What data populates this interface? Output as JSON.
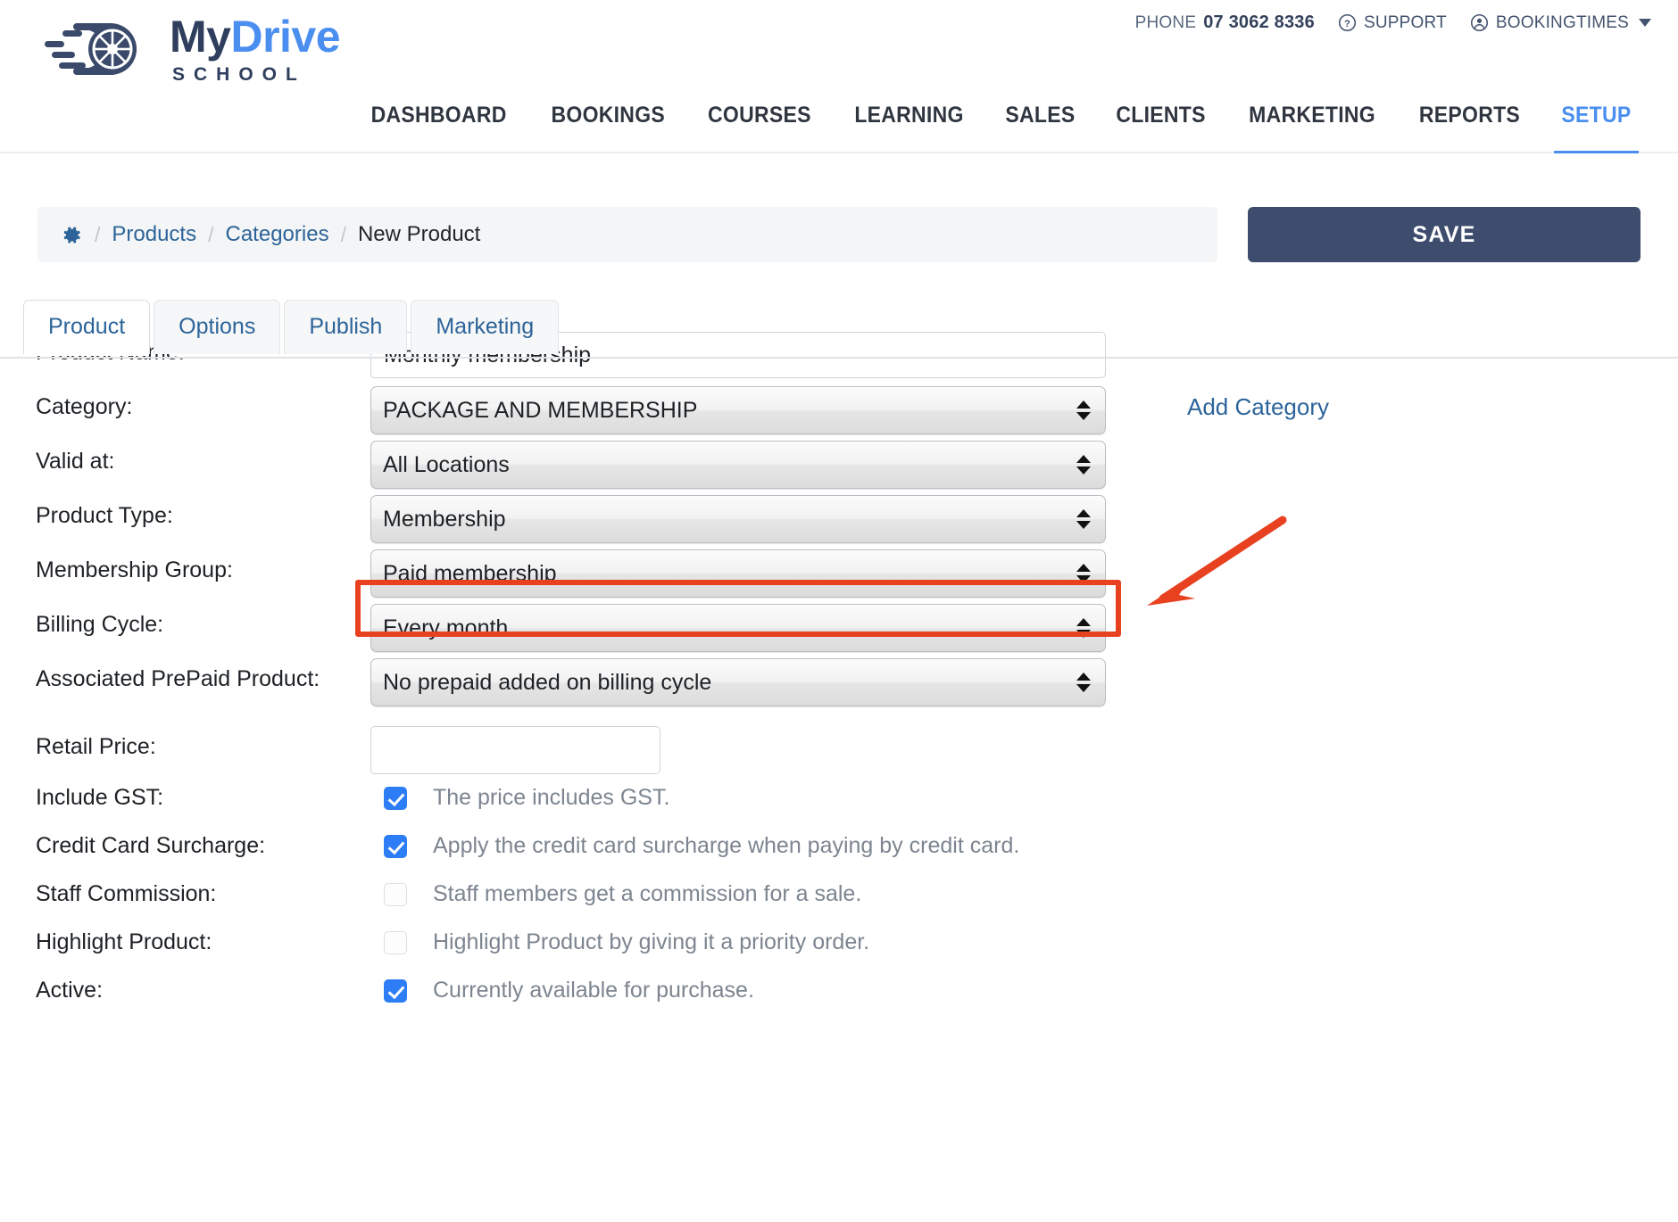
{
  "brand": {
    "logo_my": "My",
    "logo_drive": "Drive",
    "logo_sub": "SCHOOL",
    "logo_icon": "wheel-speed-icon"
  },
  "utility": {
    "phone_label": "PHONE",
    "phone_number": "07 3062 8336",
    "support_label": "SUPPORT",
    "support_icon": "question-circle-icon",
    "account_label": "BOOKINGTIMES",
    "account_icon": "user-circle-icon",
    "caret_icon": "caret-down-icon"
  },
  "nav": {
    "items": [
      {
        "label": "DASHBOARD",
        "active": false
      },
      {
        "label": "BOOKINGS",
        "active": false
      },
      {
        "label": "COURSES",
        "active": false
      },
      {
        "label": "LEARNING",
        "active": false
      },
      {
        "label": "SALES",
        "active": false
      },
      {
        "label": "CLIENTS",
        "active": false
      },
      {
        "label": "MARKETING",
        "active": false
      },
      {
        "label": "REPORTS",
        "active": false
      },
      {
        "label": "SETUP",
        "active": true
      }
    ],
    "active_color": "#4a8ef0"
  },
  "breadcrumb": {
    "gear_icon": "gear-icon",
    "sep": "/",
    "items": [
      {
        "label": "Products",
        "current": false
      },
      {
        "label": "Categories",
        "current": false
      },
      {
        "label": "New Product",
        "current": true
      }
    ]
  },
  "toolbar": {
    "save_label": "SAVE",
    "save_color": "#3e4d6d"
  },
  "tabs": [
    {
      "label": "Product",
      "active": true
    },
    {
      "label": "Options",
      "active": false
    },
    {
      "label": "Publish",
      "active": false
    },
    {
      "label": "Marketing",
      "active": false
    }
  ],
  "form": {
    "product_name": {
      "label": "Product Name:",
      "value": "Monthly membership",
      "placeholder": ""
    },
    "category": {
      "label": "Category:",
      "value": "PACKAGE AND MEMBERSHIP",
      "add_link": "Add Category"
    },
    "valid_at": {
      "label": "Valid at:",
      "value": "All Locations"
    },
    "product_type": {
      "label": "Product Type:",
      "value": "Membership",
      "highlighted": true
    },
    "membership_group": {
      "label": "Membership Group:",
      "value": "Paid membership"
    },
    "billing_cycle": {
      "label": "Billing Cycle:",
      "value": "Every month"
    },
    "prepaid_product": {
      "label": "Associated PrePaid Product:",
      "value": "No prepaid added on billing cycle"
    },
    "retail_price": {
      "label": "Retail Price:",
      "value": "",
      "placeholder": ""
    },
    "include_gst": {
      "label": "Include GST:",
      "text": "The price includes GST.",
      "checked": true
    },
    "credit_card_surcharge": {
      "label": "Credit Card Surcharge:",
      "text": "Apply the credit card surcharge when paying by credit card.",
      "checked": true
    },
    "staff_commission": {
      "label": "Staff Commission:",
      "text": "Staff members get a commission for a sale.",
      "checked": false
    },
    "highlight_product": {
      "label": "Highlight Product:",
      "text": "Highlight Product by giving it a priority order.",
      "checked": false
    },
    "active": {
      "label": "Active:",
      "text": "Currently available for purchase.",
      "checked": true
    }
  },
  "annotations": {
    "highlight_color": "#e8411f",
    "arrow_icon": "arrow-pointing-down-left-icon",
    "highlight_target": "product-type-select"
  }
}
